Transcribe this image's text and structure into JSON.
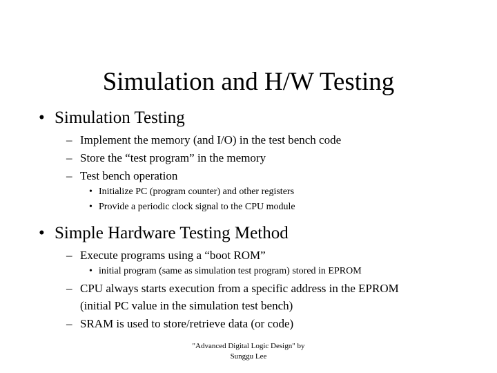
{
  "slide": {
    "title": "Simulation and H/W Testing",
    "markers": {
      "level1": "•",
      "level2": "–",
      "level3": "•"
    },
    "sections": [
      {
        "heading": "Simulation Testing",
        "items": [
          {
            "level": 2,
            "text": "Implement the memory (and I/O) in the test bench code"
          },
          {
            "level": 2,
            "text": "Store the “test program” in the memory"
          },
          {
            "level": 2,
            "text": "Test bench operation"
          },
          {
            "level": 3,
            "text": "Initialize PC (program counter) and other registers"
          },
          {
            "level": 3,
            "text": "Provide a periodic clock signal to the CPU module"
          }
        ]
      },
      {
        "heading": "Simple Hardware Testing Method",
        "items": [
          {
            "level": 2,
            "text": "Execute programs using a “boot ROM”"
          },
          {
            "level": 3,
            "text": "initial program (same as simulation test program) stored in EPROM"
          },
          {
            "level": 2,
            "text": "CPU always starts execution from a specific address in the EPROM (initial PC value in the simulation test bench)"
          },
          {
            "level": 2,
            "text": "SRAM is used to store/retrieve data (or code)"
          }
        ]
      }
    ]
  },
  "footer": {
    "line1": "\"Advanced Digital Logic Design\" by",
    "line2": "Sunggu Lee"
  }
}
